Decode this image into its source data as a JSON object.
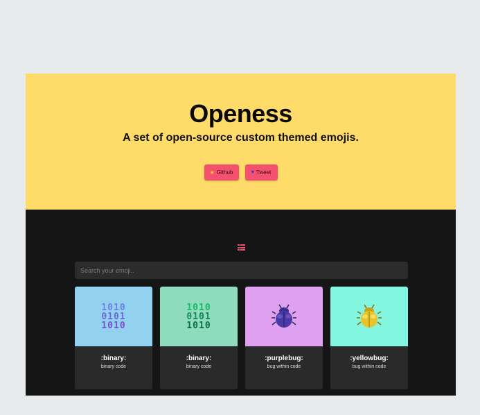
{
  "hero": {
    "title": "Openess",
    "subtitle": "A set of open-source custom themed emojis.",
    "github_label": "Github",
    "tweet_label": "Tweet",
    "background": "#ffdb6a"
  },
  "icons": {
    "github": "star-icon",
    "tweet": "bird-icon",
    "menu": "list-icon"
  },
  "search": {
    "placeholder": "Search your emoji.."
  },
  "colors": {
    "accent": "#f4516e",
    "dark_bg": "#151515",
    "card_bg": "#2a2a2a"
  },
  "cards": [
    {
      "name": ":binary:",
      "description": "binary code",
      "bg": "#93d2ef",
      "art": [
        "1010",
        "0101",
        "1010"
      ]
    },
    {
      "name": ":binary:",
      "description": "binary code",
      "bg": "#8edbbe",
      "art": [
        "1010",
        "0101",
        "1010"
      ]
    },
    {
      "name": ":purplebug:",
      "description": "bug within code",
      "bg": "#dfa1ef"
    },
    {
      "name": ":yellowbug:",
      "description": "bug within code",
      "bg": "#82f6df"
    }
  ]
}
